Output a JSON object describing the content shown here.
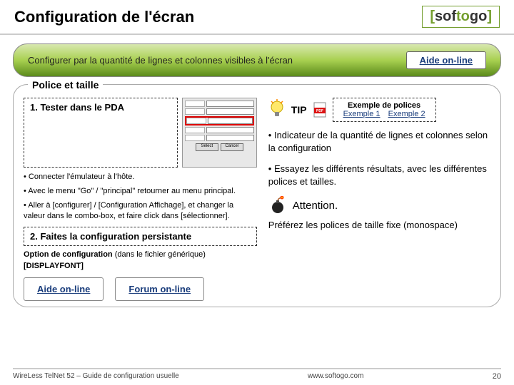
{
  "header": {
    "title": "Configuration de l'écran",
    "logo": {
      "bracket_open": "[",
      "sof": "sof",
      "to": "to",
      "go": "go",
      "bracket_close": "]"
    }
  },
  "subtitle": "Configurer par la quantité de lignes et colonnes visibles à l'écran",
  "help_link": "Aide on-line",
  "section_label": "Police et taille",
  "left": {
    "step1": "1. Tester dans le PDA",
    "pda": {
      "select_btn": "Select",
      "cancel_btn": "Cancel"
    },
    "bullets": [
      "Connecter l'émulateur à l'hôte.",
      "Avec le menu \"Go\" / \"principal\" retourner au menu principal.",
      "Aller à [configurer] / [Configuration Affichage], et changer la valeur dans le combo-box, et faire click dans [sélectionner]."
    ],
    "step2": "2. Faites la configuration persistante",
    "option_label": "Option de configuration",
    "option_note": "(dans le fichier générique)",
    "displayfont": "[DISPLAYFONT]",
    "link1": "Aide on-line",
    "link2": "Forum on-line"
  },
  "right": {
    "tip_label": "TIP",
    "example_title": "Exemple de polices",
    "example_link1": "Exemple 1",
    "example_link2": "Exemple 2",
    "bullet1": "Indicateur de la quantité de lignes et colonnes selon la configuration",
    "bullet2": "Essayez les différents résultats, avec les différentes polices et tailles.",
    "attention_label": "Attention.",
    "attention_text": "Préférez les polices de taille fixe (monospace)"
  },
  "footer": {
    "left": "WireLess TelNet 52 – Guide de configuration usuelle",
    "center": "www.softogo.com",
    "page": "20"
  }
}
